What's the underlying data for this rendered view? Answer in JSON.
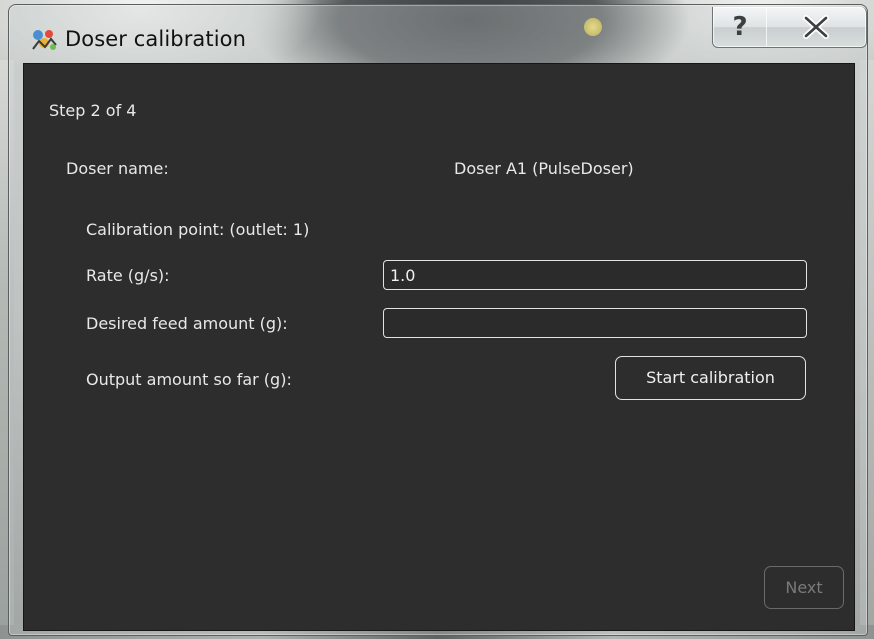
{
  "window": {
    "title": "Doser calibration",
    "app_icon": "doser-app-icon",
    "help_glyph": "?",
    "help_icon": "help-icon",
    "close_icon": "close-icon"
  },
  "wizard": {
    "step_label": "Step 2 of 4"
  },
  "doser": {
    "name_label": "Doser name:",
    "name_value": "Doser A1 (PulseDoser)"
  },
  "calibration": {
    "point_label": "Calibration point:   (outlet: 1)",
    "rate_label": "Rate (g/s):",
    "rate_value": "1.0",
    "feed_label": "Desired feed amount (g):",
    "feed_value": "",
    "output_label": "Output amount so far (g):",
    "start_button": "Start calibration"
  },
  "footer": {
    "next_button": "Next",
    "next_enabled": false
  },
  "colors": {
    "panel_background": "#2d2d2d",
    "text": "#e8e8e8",
    "field_border": "#e2e2e2",
    "disabled_text": "#7a7a7a"
  }
}
